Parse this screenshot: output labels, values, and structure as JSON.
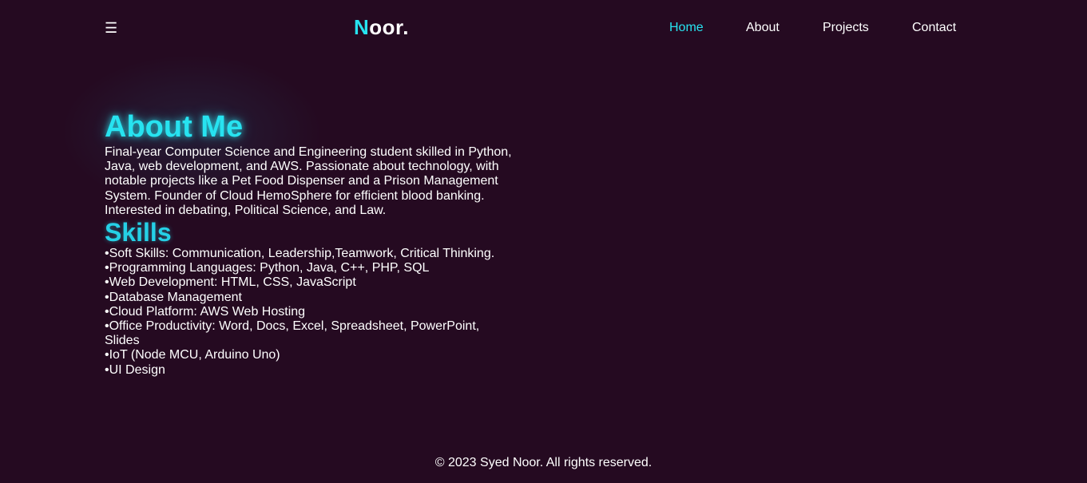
{
  "header": {
    "menu_icon": "☰",
    "logo_accent": "N",
    "logo_rest": "oor.",
    "nav": [
      "Home",
      "About",
      "Projects",
      "Contact"
    ],
    "active_nav": "Home"
  },
  "about": {
    "title": "About Me",
    "text": "Final-year Computer Science and Engineering student skilled in Python, Java, web development, and AWS. Passionate about technology, with notable projects like a Pet Food Dispenser and a Prison Management System. Founder of Cloud HemoSphere for efficient blood banking. Interested in debating, Political Science, and Law."
  },
  "skills": {
    "title": "Skills",
    "items": [
      "Soft Skills: Communication, Leadership,Teamwork, Critical Thinking.",
      "Programming Languages: Python, Java, C++, PHP, SQL",
      "Web Development: HTML, CSS, JavaScript",
      "Database Management",
      "Cloud Platform: AWS Web Hosting",
      "Office Productivity: Word, Docs, Excel, Spreadsheet, PowerPoint, Slides",
      "IoT (Node MCU, Arduino Uno)",
      "UI Design"
    ]
  },
  "footer": {
    "text": "© 2023 Syed Noor. All rights reserved."
  },
  "colors": {
    "background": "#250a21",
    "accent": "#27e3f0",
    "text": "#ffffff"
  },
  "icons": {
    "menu": "hamburger-menu-icon"
  }
}
